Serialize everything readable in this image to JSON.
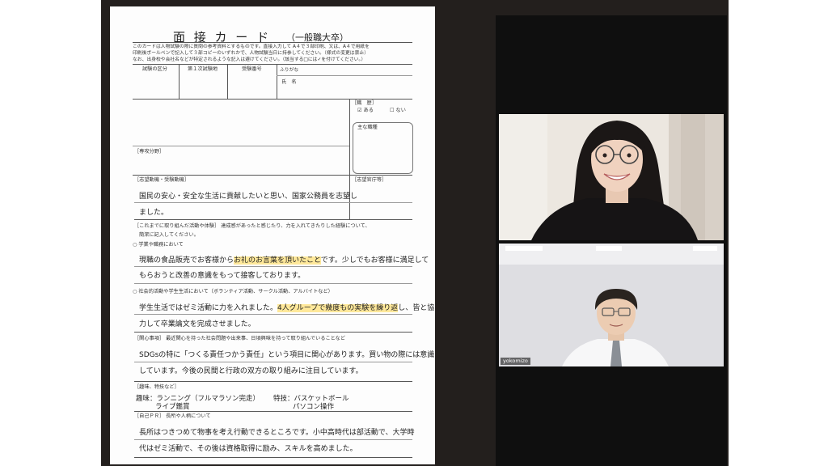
{
  "form": {
    "title": "面 接 カ ー ド",
    "subtitle": "（一般職大卒）",
    "intro1": "このカードは人物試験の際に質問の参考資料とするものです。直接入力して A４で３部印刷、又は、A４で用紙を",
    "intro2": "印刷後ボールペンで記入して３部コピーのいずれかで、人物試験当日に持参してください。（様式の変更は禁止）",
    "intro3": "なお、出身校や会社名などが特定されるような記入は避けてください。（該当する□には✓を付けてください。）",
    "labels": {
      "exam_category": "試験の区分",
      "first_exam_site": "第１次試験地",
      "exam_number": "受験番号",
      "furigana": "ふりがな",
      "name": "氏　名",
      "job_history": "［職　歴］",
      "yes": "ある",
      "no": "ない",
      "main_duties": "主な職種",
      "major": "［専攻分野］",
      "motivation": "［志望動機・受験動機］",
      "desired_office": "［志望官庁等］",
      "efforts_head": "［これまでに取り組んだ活動や体験］ 達成感があったと感じたり、力を入れてきたりした経験について、",
      "efforts_head2": "簡潔に記入してください。",
      "school_work": "○ 学業や職務において",
      "social": "○ 社会的活動や学生生活において（ボランティア活動、サークル活動、アルバイトなど）",
      "interests": "［関心事項］ 最近関心を持った社会問題や出来事、日頃興味を持って取り組んでいることなど",
      "hobbies": "［趣味、特技など］",
      "self_pr": "［自己ＰＲ］ 長所や人柄について"
    },
    "answers": {
      "motivation_1": "国民の安心・安全な生活に貢献したいと思い、国家公務員を志望し",
      "motivation_2": "ました。",
      "school_1a": "現職の食品販売でお客様から",
      "school_1b": "お礼のお言葉を頂いたこと",
      "school_1c": "です。少しでもお客様に満足して",
      "school_2": "もらおうと改善の意識をもって接客しております。",
      "social_1a": "学生生活ではゼミ活動に力を入れました。",
      "social_1b": "4人グループで幾度もの実験を繰り返",
      "social_1c": "し、皆と協",
      "social_2": "力して卒業論文を完成させました。",
      "interests_1": "SDGsの特に「つくる責任つかう責任」という項目に関心があります。買い物の際には意識",
      "interests_2": "しています。今後の民間と行政の双方の取り組みに注目しています。",
      "hobby_1": "趣味：ランニング（フルマラソン完走）",
      "hobby_2": "ライブ鑑賞",
      "skill_1": "特技：バスケットボール",
      "skill_2": "パソコン操作",
      "pr_1": "長所はつきつめて物事を考え行動できるところです。小中高時代は部活動で、大学時",
      "pr_2": "代はゼミ活動で、その後は資格取得に励み、スキルを高めました。"
    }
  },
  "video": {
    "participant2_name": "yokomizo"
  }
}
